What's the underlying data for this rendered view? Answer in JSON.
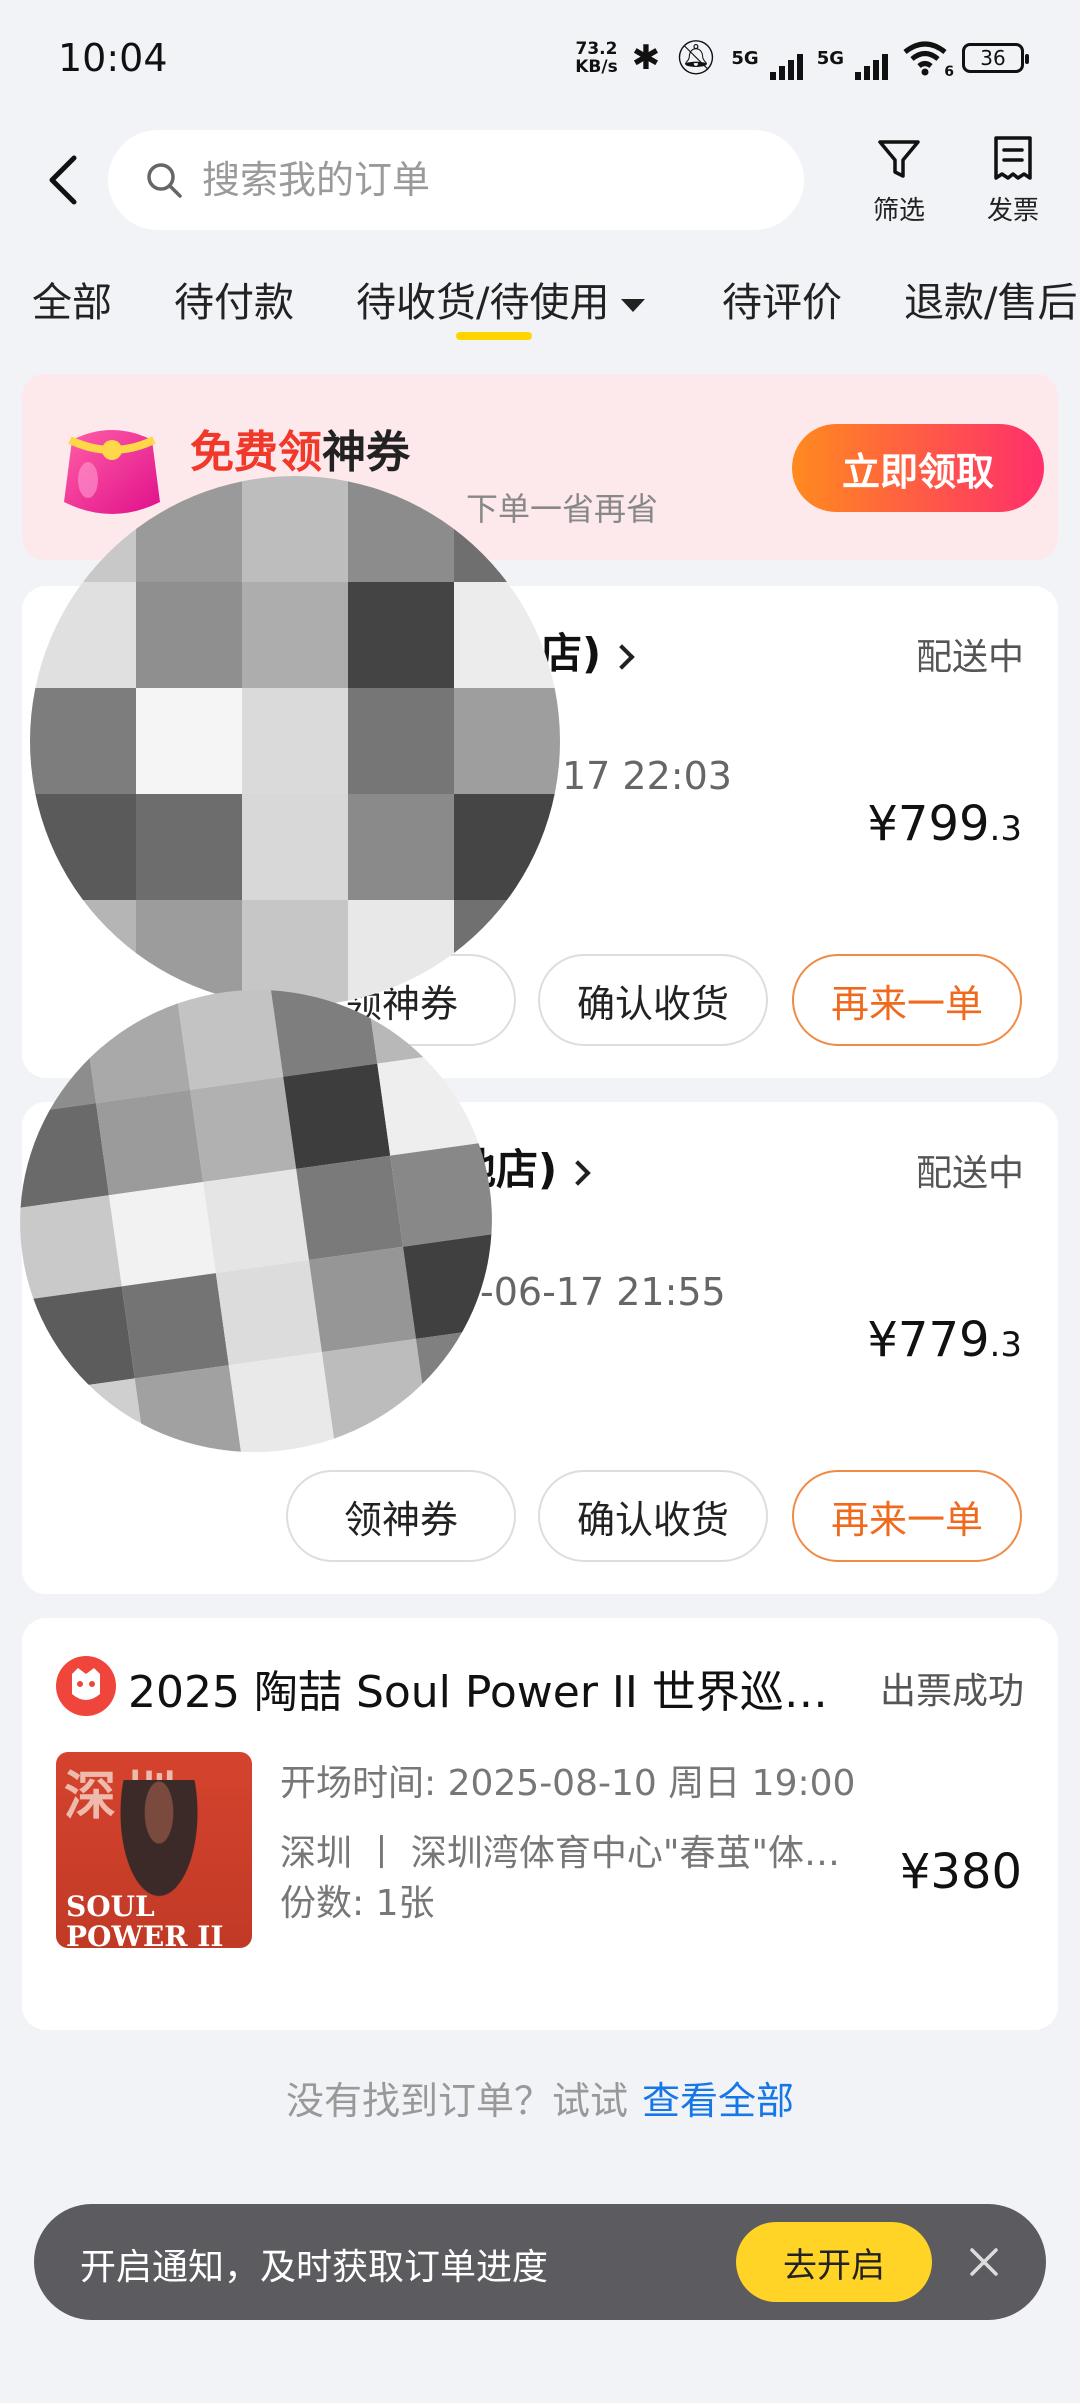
{
  "status_bar": {
    "time": "10:04",
    "net_speed_value": "73.2",
    "net_speed_unit": "KB/s",
    "sim1": "5G",
    "sim2": "5G",
    "wifi_badge": "6",
    "battery": "36"
  },
  "header": {
    "search_placeholder": "搜索我的订单",
    "filter_label": "筛选",
    "invoice_label": "发票"
  },
  "tabs": [
    {
      "label": "全部"
    },
    {
      "label": "待付款"
    },
    {
      "label": "待收货/待使用"
    },
    {
      "label": "待评价"
    },
    {
      "label": "退款/售后"
    }
  ],
  "promo": {
    "title_highlight": "免费领",
    "title_rest": "神券",
    "subtitle": "下单一省再省",
    "button": "立即领取"
  },
  "orders": [
    {
      "store_suffix": "店)",
      "status": "配送中",
      "time": "17 22:03",
      "price_int": "¥799",
      "price_dec": ".3",
      "buttons": [
        "领神券",
        "确认收货",
        "再来一单"
      ]
    },
    {
      "store_suffix": "地店)",
      "status": "配送中",
      "time": "-06-17 21:55",
      "price_int": "¥779",
      "price_dec": ".3",
      "buttons": [
        "领神券",
        "确认收货",
        "再来一单"
      ]
    }
  ],
  "concert": {
    "title": "2025 陶喆 Soul Power II 世界巡回…",
    "status": "出票成功",
    "showtime": "开场时间: 2025-08-10 周日 19:00",
    "venue": "深圳 丨 深圳湾体育中心\"春茧\"体…",
    "quantity": "份数: 1张",
    "price": "¥380",
    "poster_top": "深圳",
    "poster_bottom": "SOUL POWER II"
  },
  "footer_hint": {
    "text": "没有找到订单？试试",
    "link": "查看全部"
  },
  "notification": {
    "text": "开启通知，及时获取订单进度",
    "button": "去开启"
  },
  "colors": {
    "accent_yellow": "#ffd400",
    "promo_gradient_start": "#ff8a1e",
    "promo_gradient_end": "#ff2f6b",
    "link_blue": "#1677e6",
    "reorder_orange": "#f06a1e"
  }
}
